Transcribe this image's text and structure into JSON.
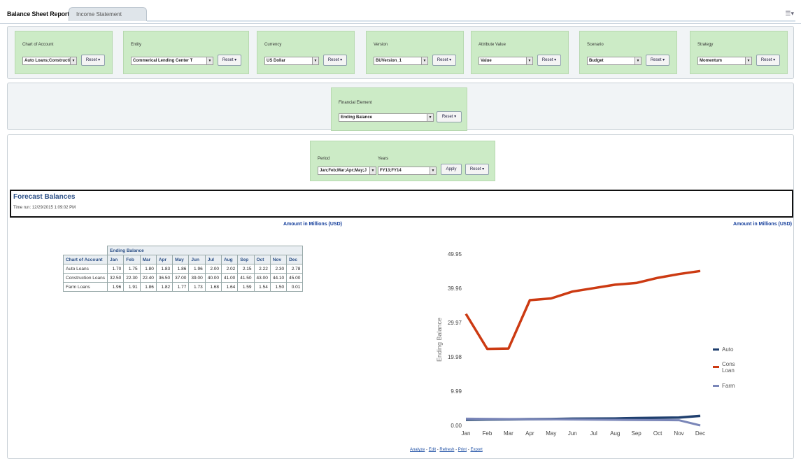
{
  "tabs": {
    "active": "Balance Sheet Reports",
    "inactive": "Income Statement Reports"
  },
  "prompts": [
    {
      "label": "Chart of Account",
      "value": "Auto Loans;Constructio",
      "reset": "Reset ▾"
    },
    {
      "label": "Entity",
      "value": "Commerical Lending Center T",
      "reset": "Reset ▾"
    },
    {
      "label": "Currency",
      "value": "US Dollar",
      "reset": "Reset ▾"
    },
    {
      "label": "Version",
      "value": "BUVersion_1",
      "reset": "Reset ▾"
    },
    {
      "label": "Attribute Value",
      "value": "Value",
      "reset": "Reset ▾"
    },
    {
      "label": "Scenario",
      "value": "Budget",
      "reset": "Reset ▾"
    },
    {
      "label": "Strategy",
      "value": "Momentum",
      "reset": "Reset ▾"
    }
  ],
  "financial_element": {
    "label": "Financial Element",
    "value": "Ending Balance",
    "reset": "Reset ▾"
  },
  "period": {
    "label": "Period",
    "value": "Jan;Feb;Mar;Apr;May;J"
  },
  "years": {
    "label": "Years",
    "value": "FY13;FY14"
  },
  "apply_label": "Apply",
  "reset_label": "Reset ▾",
  "report": {
    "title": "Forecast Balances",
    "time_run": "Time run: 12/29/2015 1:09:02 PM",
    "units_left": "Amount in Millions (USD)",
    "units_right": "Amount in Millions (USD)"
  },
  "table": {
    "measure": "Ending Balance",
    "row_header": "Chart of Account",
    "months": [
      "Jan",
      "Feb",
      "Mar",
      "Apr",
      "May",
      "Jun",
      "Jul",
      "Aug",
      "Sep",
      "Oct",
      "Nov",
      "Dec"
    ],
    "rows": [
      {
        "name": "Auto Loans",
        "values": [
          "1.70",
          "1.75",
          "1.80",
          "1.83",
          "1.86",
          "1.96",
          "2.00",
          "2.02",
          "2.15",
          "2.22",
          "2.30",
          "2.78"
        ]
      },
      {
        "name": "Construction Loans",
        "values": [
          "32.50",
          "22.30",
          "22.40",
          "36.50",
          "37.00",
          "39.00",
          "40.00",
          "41.00",
          "41.50",
          "43.00",
          "44.10",
          "45.00"
        ]
      },
      {
        "name": "Farm Loans",
        "values": [
          "1.96",
          "1.91",
          "1.86",
          "1.82",
          "1.77",
          "1.73",
          "1.68",
          "1.64",
          "1.59",
          "1.54",
          "1.50",
          "0.01"
        ]
      }
    ]
  },
  "footer": {
    "analyze": "Analyze",
    "edit": "Edit",
    "refresh": "Refresh",
    "print": "Print",
    "export": "Export",
    "sep": " - "
  },
  "colors": {
    "auto": "#1f3f6e",
    "construction": "#cc3a12",
    "farm": "#7a86b8"
  },
  "chart_data": {
    "type": "line",
    "ylabel": "Ending Balance",
    "categories": [
      "Jan",
      "Feb",
      "Mar",
      "Apr",
      "May",
      "Jun",
      "Jul",
      "Aug",
      "Sep",
      "Oct",
      "Nov",
      "Dec"
    ],
    "yticks": [
      "0.00",
      "9.99",
      "19.98",
      "29.97",
      "39.96",
      "49.95"
    ],
    "ylim": [
      0,
      49.95
    ],
    "legend_position": "right",
    "series": [
      {
        "name": "Auto",
        "color": "#1f3f6e",
        "values": [
          1.7,
          1.75,
          1.8,
          1.83,
          1.86,
          1.96,
          2.0,
          2.02,
          2.15,
          2.22,
          2.3,
          2.78
        ]
      },
      {
        "name": "Cons Loan",
        "color": "#cc3a12",
        "values": [
          32.5,
          22.3,
          22.4,
          36.5,
          37.0,
          39.0,
          40.0,
          41.0,
          41.5,
          43.0,
          44.1,
          45.0
        ]
      },
      {
        "name": "Farm",
        "color": "#7a86b8",
        "values": [
          1.96,
          1.91,
          1.86,
          1.82,
          1.77,
          1.73,
          1.68,
          1.64,
          1.59,
          1.54,
          1.5,
          0.01
        ]
      }
    ],
    "legend_labels": [
      "Auto",
      "Cons Loan",
      "Farm"
    ]
  }
}
